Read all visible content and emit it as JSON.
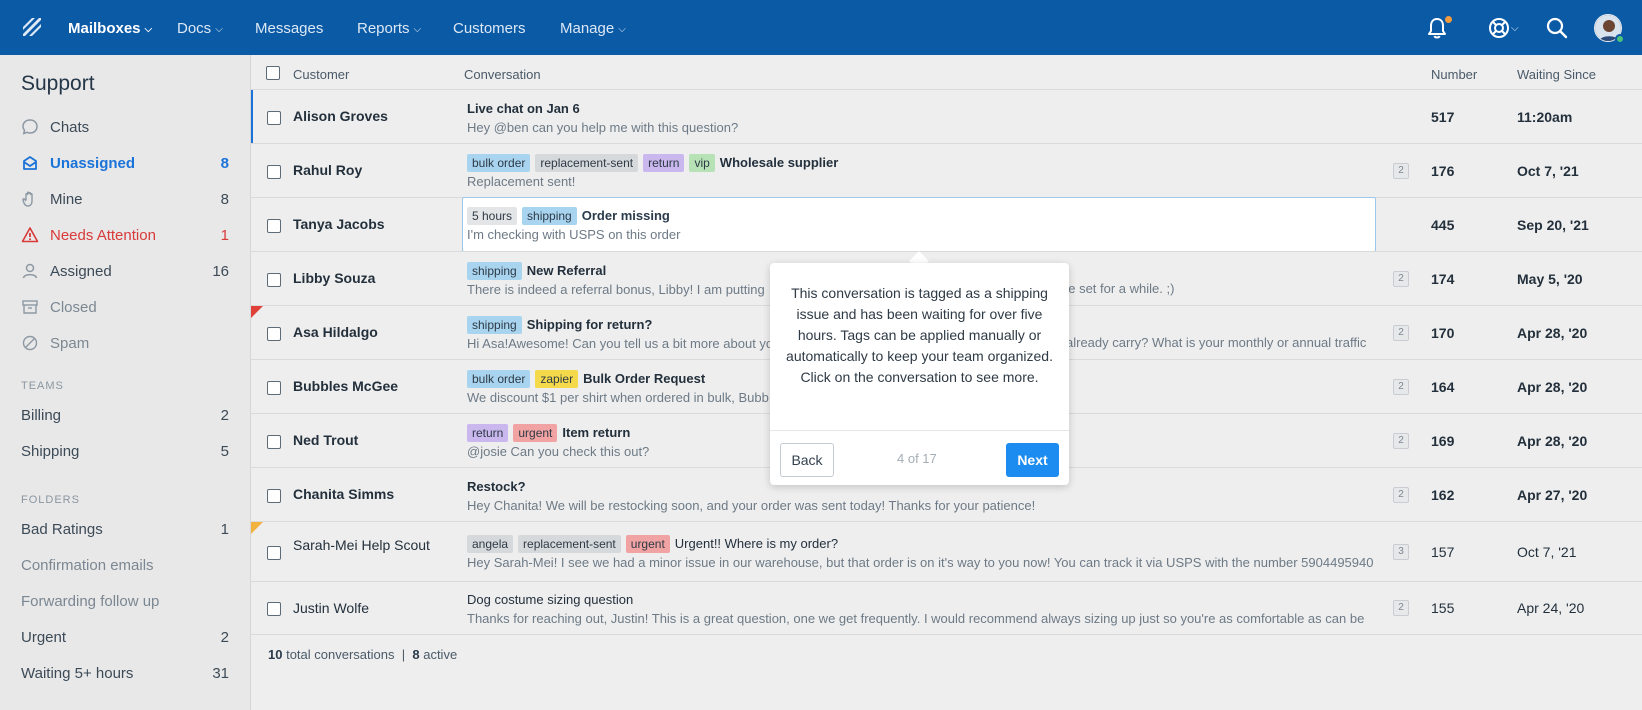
{
  "colors": {
    "topbar": "#0b5aa6",
    "accent": "#1a73d9",
    "alert": "#d93a3a",
    "next_button": "#1d8cf0"
  },
  "nav": {
    "items": [
      {
        "label": "Mailboxes",
        "dropdown": true
      },
      {
        "label": "Docs",
        "dropdown": true
      },
      {
        "label": "Messages",
        "dropdown": false
      },
      {
        "label": "Reports",
        "dropdown": true
      },
      {
        "label": "Customers",
        "dropdown": false
      },
      {
        "label": "Manage",
        "dropdown": true
      }
    ],
    "icons": [
      "bell-icon",
      "help-lifebuoy-icon",
      "search-icon",
      "avatar"
    ]
  },
  "sidebar": {
    "title": "Support",
    "items": [
      {
        "label": "Chats",
        "count": "",
        "icon": "chat-bubble-icon"
      },
      {
        "label": "Unassigned",
        "count": "8",
        "icon": "inbox-icon"
      },
      {
        "label": "Mine",
        "count": "8",
        "icon": "hand-icon"
      },
      {
        "label": "Needs Attention",
        "count": "1",
        "icon": "warning-icon"
      },
      {
        "label": "Assigned",
        "count": "16",
        "icon": "person-icon"
      },
      {
        "label": "Closed",
        "count": "",
        "icon": "archive-icon"
      },
      {
        "label": "Spam",
        "count": "",
        "icon": "spam-icon"
      }
    ],
    "teams_heading": "TEAMS",
    "teams": [
      {
        "label": "Billing",
        "count": "2"
      },
      {
        "label": "Shipping",
        "count": "5"
      }
    ],
    "folders_heading": "FOLDERS",
    "folders": [
      {
        "label": "Bad Ratings",
        "count": "1"
      },
      {
        "label": "Confirmation emails",
        "count": ""
      },
      {
        "label": "Forwarding follow up",
        "count": ""
      },
      {
        "label": "Urgent",
        "count": "2"
      },
      {
        "label": "Waiting 5+ hours",
        "count": "31"
      }
    ]
  },
  "table": {
    "headers": {
      "customer": "Customer",
      "conversation": "Conversation",
      "number": "Number",
      "waiting": "Waiting Since"
    },
    "rows": [
      {
        "customer": "Alison Groves",
        "tags": [],
        "subject": "Live chat on Jan 6",
        "preview": "Hey @ben can you help me with this question?",
        "threads": "",
        "number": "517",
        "waiting": "11:20am"
      },
      {
        "customer": "Rahul Roy",
        "tags": [
          "bulk order",
          "replacement-sent",
          "return",
          "vip"
        ],
        "subject": "Wholesale supplier",
        "preview": "Replacement sent!",
        "threads": "2",
        "number": "176",
        "waiting": "Oct 7, '21"
      },
      {
        "customer": "Tanya Jacobs",
        "tags": [
          "5 hours",
          "shipping"
        ],
        "subject": "Order missing",
        "preview": "I'm checking with USPS on this order",
        "threads": "",
        "number": "445",
        "waiting": "Sep 20, '21"
      },
      {
        "customer": "Libby Souza",
        "tags": [
          "shipping"
        ],
        "subject": "New Referral",
        "preview": "There is indeed a referral bonus, Libby! I am putting",
        "preview_tail": "be set for a while. ;)",
        "threads": "2",
        "number": "174",
        "waiting": "May 5, '20"
      },
      {
        "customer": "Asa Hildalgo",
        "tags": [
          "shipping"
        ],
        "subject": "Shipping for return?",
        "preview": "Hi Asa!Awesome! Can you tell us a bit more about yo",
        "preview_tail": "already carry? What is your monthly or annual traffic",
        "threads": "2",
        "number": "170",
        "waiting": "Apr 28, '20"
      },
      {
        "customer": "Bubbles McGee",
        "tags": [
          "bulk order",
          "zapier"
        ],
        "subject": "Bulk Order Request",
        "preview": "We discount $1 per shirt when ordered in bulk, Bubb",
        "threads": "2",
        "number": "164",
        "waiting": "Apr 28, '20"
      },
      {
        "customer": "Ned Trout",
        "tags": [
          "return",
          "urgent"
        ],
        "subject": "Item return",
        "preview": "@josie Can  you check this out?",
        "threads": "2",
        "number": "169",
        "waiting": "Apr 28, '20"
      },
      {
        "customer": "Chanita Simms",
        "tags": [],
        "subject": "Restock?",
        "preview": "Hey Chanita! We will be restocking soon, and your order was sent today! Thanks for your patience!",
        "threads": "2",
        "number": "162",
        "waiting": "Apr 27, '20"
      },
      {
        "customer": "Sarah-Mei Help Scout",
        "tags": [
          "angela",
          "replacement-sent",
          "urgent"
        ],
        "subject": "Urgent!! Where is my order?",
        "preview": "Hey Sarah-Mei! I see we had a minor issue in our warehouse, but that order is on it's way to you now! You can track it via USPS with the number 5904495940",
        "threads": "3",
        "number": "157",
        "waiting": "Oct 7, '21"
      },
      {
        "customer": "Justin Wolfe",
        "tags": [],
        "subject": "Dog costume sizing question",
        "preview": "Thanks for reaching out, Justin! This is a great question, one we get frequently. I would recommend always sizing up just so you're as comfortable as can be",
        "threads": "2",
        "number": "155",
        "waiting": "Apr 24, '20"
      }
    ]
  },
  "footer": {
    "total": "10",
    "total_label": "total conversations",
    "separator": "|",
    "active": "8",
    "active_label": "active"
  },
  "tour": {
    "text": "This conversation is tagged as a shipping issue and has been waiting for over five hours. Tags can be applied manually or automatically to keep your team organized. Click on the conversation to see more.",
    "back": "Back",
    "progress": "4 of 17",
    "next": "Next"
  }
}
